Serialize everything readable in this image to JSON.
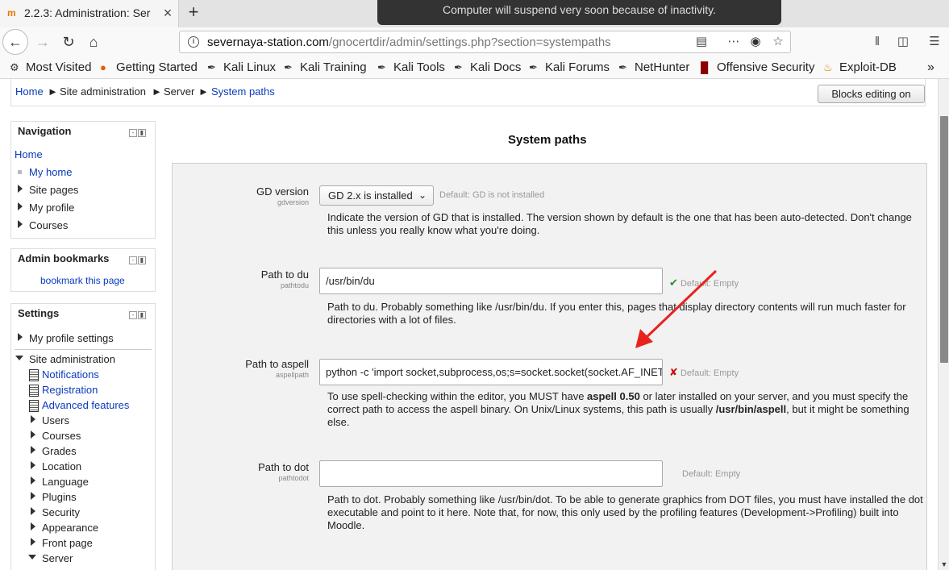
{
  "browser": {
    "tab_title": "2.2.3: Administration: Ser",
    "tab_favicon": "m",
    "toast": "Computer will suspend very soon because of inactivity.",
    "url_host": "severnaya-station.com",
    "url_path": "/gnocertdir/admin/settings.php?section=systempaths",
    "bookmarks": [
      "Most Visited",
      "Getting Started",
      "Kali Linux",
      "Kali Training",
      "Kali Tools",
      "Kali Docs",
      "Kali Forums",
      "NetHunter",
      "Offensive Security",
      "Exploit-DB"
    ]
  },
  "breadcrumb": {
    "home": "Home",
    "site_admin": "Site administration",
    "server": "Server",
    "current": "System paths",
    "sep": "►"
  },
  "blocks_button": "Blocks editing on",
  "navigation": {
    "title": "Navigation",
    "home": "Home",
    "items": [
      "My home",
      "Site pages",
      "My profile",
      "Courses"
    ]
  },
  "admin_bookmarks": {
    "title": "Admin bookmarks",
    "link": "bookmark this page"
  },
  "settings_block": {
    "title": "Settings",
    "profile": "My profile settings",
    "site_admin": "Site administration",
    "docs": [
      "Notifications",
      "Registration",
      "Advanced features"
    ],
    "items": [
      "Users",
      "Courses",
      "Grades",
      "Location",
      "Language",
      "Plugins",
      "Security",
      "Appearance",
      "Front page"
    ],
    "server": "Server"
  },
  "main": {
    "title": "System paths",
    "gd": {
      "label": "GD version",
      "sub": "gdversion",
      "value": "GD 2.x is installed",
      "default": "Default: GD is not installed",
      "desc": "Indicate the version of GD that is installed. The version shown by default is the one that has been auto-detected. Don't change this unless you really know what you're doing."
    },
    "du": {
      "label": "Path to du",
      "sub": "pathtodu",
      "value": "/usr/bin/du",
      "default": "Default: Empty",
      "desc": "Path to du. Probably something like /usr/bin/du. If you enter this, pages that display directory contents will run much faster for directories with a lot of files."
    },
    "aspell": {
      "label": "Path to aspell",
      "sub": "aspellpath",
      "value": "python -c 'import socket,subprocess,os;s=socket.socket(socket.AF_INET",
      "default": "Default: Empty",
      "desc_a": "To use spell-checking within the editor, you MUST have ",
      "desc_b": "aspell 0.50",
      "desc_c": " or later installed on your server, and you must specify the correct path to access the aspell binary. On Unix/Linux systems, this path is usually ",
      "desc_d": "/usr/bin/aspell",
      "desc_e": ", but it might be something else."
    },
    "dot": {
      "label": "Path to dot",
      "sub": "pathtodot",
      "value": "",
      "default": "Default: Empty",
      "desc": "Path to dot. Probably something like /usr/bin/dot. To be able to generate graphics from DOT files, you must have installed the dot executable and point to it here. Note that, for now, this only used by the profiling features (Development->Profiling) built into Moodle."
    }
  },
  "colors": {
    "link": "#0a3bbd",
    "arrow": "#e8231f"
  }
}
